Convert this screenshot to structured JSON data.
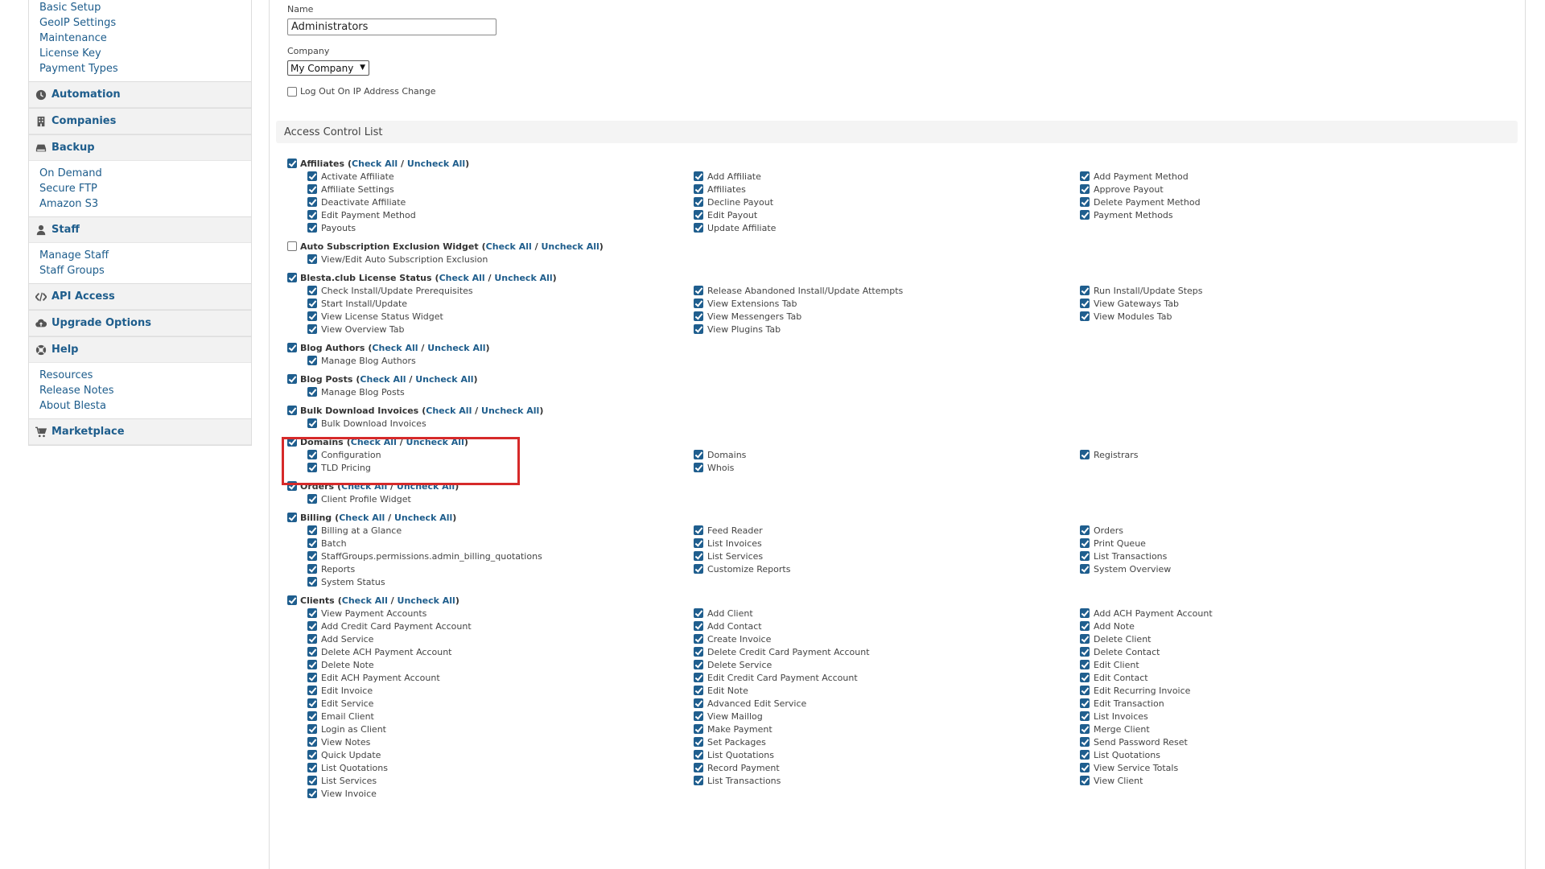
{
  "sidebar": {
    "settings_items": [
      "Basic Setup",
      "GeoIP Settings",
      "Maintenance",
      "License Key",
      "Payment Types"
    ],
    "automation": "Automation",
    "companies": "Companies",
    "backup": "Backup",
    "backup_items": [
      "On Demand",
      "Secure FTP",
      "Amazon S3"
    ],
    "staff": "Staff",
    "staff_items": [
      "Manage Staff",
      "Staff Groups"
    ],
    "api_access": "API Access",
    "upgrade_options": "Upgrade Options",
    "help": "Help",
    "help_items": [
      "Resources",
      "Release Notes",
      "About Blesta"
    ],
    "marketplace": "Marketplace"
  },
  "form": {
    "name_label": "Name",
    "name_value": "Administrators",
    "company_label": "Company",
    "company_value": "My Company",
    "logout_label": "Log Out On IP Address Change",
    "logout_checked": false,
    "acl_title": "Access Control List"
  },
  "acl": {
    "check_all": "Check All",
    "uncheck_all": "Uncheck All",
    "groups": [
      {
        "name": "Affiliates",
        "checked": true,
        "perms": [
          "Activate Affiliate",
          "Add Affiliate",
          "Add Payment Method",
          "Affiliate Settings",
          "Affiliates",
          "Approve Payout",
          "Deactivate Affiliate",
          "Decline Payout",
          "Delete Payment Method",
          "Edit Payment Method",
          "Edit Payout",
          "Payment Methods",
          "Payouts",
          "Update Affiliate"
        ]
      },
      {
        "name": "Auto Subscription Exclusion Widget",
        "checked": false,
        "perms": [
          "View/Edit Auto Subscription Exclusion"
        ]
      },
      {
        "name": "Blesta.club License Status",
        "checked": true,
        "perms": [
          "Check Install/Update Prerequisites",
          "Release Abandoned Install/Update Attempts",
          "Run Install/Update Steps",
          "Start Install/Update",
          "View Extensions Tab",
          "View Gateways Tab",
          "View License Status Widget",
          "View Messengers Tab",
          "View Modules Tab",
          "View Overview Tab",
          "View Plugins Tab"
        ]
      },
      {
        "name": "Blog Authors",
        "checked": true,
        "perms": [
          "Manage Blog Authors"
        ]
      },
      {
        "name": "Blog Posts",
        "checked": true,
        "perms": [
          "Manage Blog Posts"
        ]
      },
      {
        "name": "Bulk Download Invoices",
        "checked": true,
        "perms": [
          "Bulk Download Invoices"
        ]
      },
      {
        "name": "Domains",
        "checked": true,
        "perms": [
          "Configuration",
          "Domains",
          "Registrars",
          "TLD Pricing",
          "Whois"
        ]
      },
      {
        "name": "Orders",
        "checked": true,
        "perms": [
          "Client Profile Widget"
        ]
      },
      {
        "name": "Billing",
        "checked": true,
        "perms": [
          "Billing at a Glance",
          "Feed Reader",
          "Orders",
          "Batch",
          "List Invoices",
          "Print Queue",
          "StaffGroups.permissions.admin_billing_quotations",
          "List Services",
          "List Transactions",
          "Reports",
          "Customize Reports",
          "System Overview",
          "System Status"
        ]
      },
      {
        "name": "Clients",
        "checked": true,
        "perms": [
          "View Payment Accounts",
          "Add Client",
          "Add ACH Payment Account",
          "Add Credit Card Payment Account",
          "Add Contact",
          "Add Note",
          "Add Service",
          "Create Invoice",
          "Delete Client",
          "Delete ACH Payment Account",
          "Delete Credit Card Payment Account",
          "Delete Contact",
          "Delete Note",
          "Delete Service",
          "Edit Client",
          "Edit ACH Payment Account",
          "Edit Credit Card Payment Account",
          "Edit Contact",
          "Edit Invoice",
          "Edit Note",
          "Edit Recurring Invoice",
          "Edit Service",
          "Advanced Edit Service",
          "Edit Transaction",
          "Email Client",
          "View Maillog",
          "List Invoices",
          "Login as Client",
          "Make Payment",
          "Merge Client",
          "View Notes",
          "Set Packages",
          "Send Password Reset",
          "Quick Update",
          "List Quotations",
          "List Quotations",
          "List Quotations",
          "Record Payment",
          "View Service Totals",
          "List Services",
          "List Transactions",
          "View Client",
          "View Invoice"
        ]
      }
    ]
  },
  "colors": {
    "accent": "#1e5d8c",
    "highlight": "#d62a2a"
  }
}
